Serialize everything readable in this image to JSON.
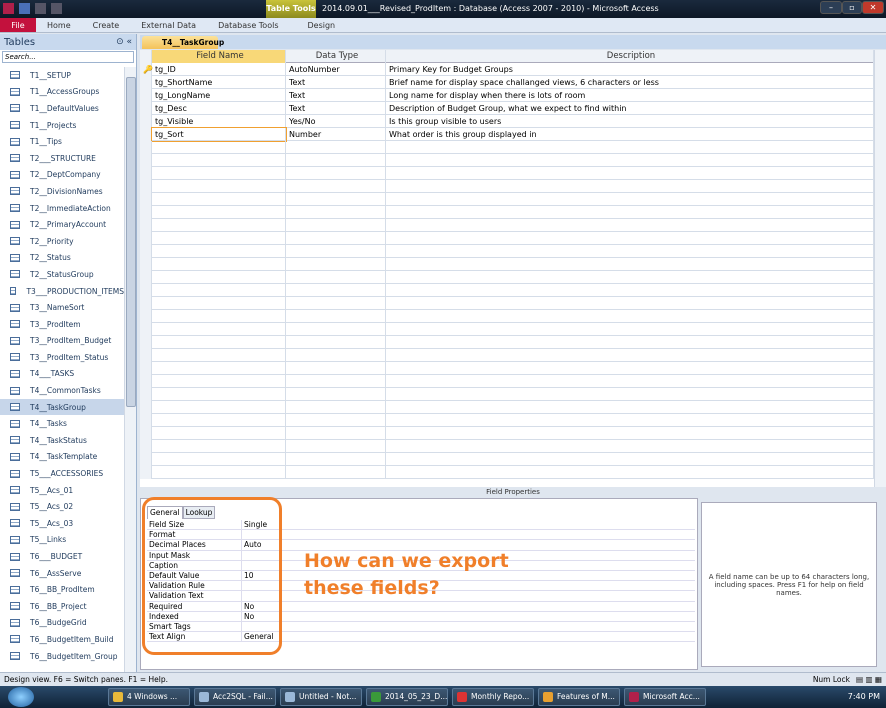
{
  "titlebar": {
    "context": "Table Tools",
    "title": "2014.09.01___Revised_ProdItem : Database (Access 2007 - 2010)  -  Microsoft Access",
    "min": "–",
    "max": "▫",
    "close": "✕"
  },
  "ribbon": {
    "tabs": [
      "File",
      "Home",
      "Create",
      "External Data",
      "Database Tools",
      "Design"
    ]
  },
  "nav": {
    "header": "Tables",
    "search_placeholder": "Search...",
    "items": [
      "T1__SETUP",
      "T1__AccessGroups",
      "T1__DefaultValues",
      "T1__Projects",
      "T1__Tips",
      "T2___STRUCTURE",
      "T2__DeptCompany",
      "T2__DivisionNames",
      "T2__ImmediateAction",
      "T2__PrimaryAccount",
      "T2__Priority",
      "T2__Status",
      "T2__StatusGroup",
      "T3___PRODUCTION_ITEMS",
      "T3__NameSort",
      "T3__ProdItem",
      "T3__ProdItem_Budget",
      "T3__ProdItem_Status",
      "T4___TASKS",
      "T4__CommonTasks",
      "T4__TaskGroup",
      "T4__Tasks",
      "T4__TaskStatus",
      "T4__TaskTemplate",
      "T5___ACCESSORIES",
      "T5__Acs_01",
      "T5__Acs_02",
      "T5__Acs_03",
      "T5__Links",
      "T6___BUDGET",
      "T6__AssServe",
      "T6__BB_ProdItem",
      "T6__BB_Project",
      "T6__BudgeGrid",
      "T6__BudgetItem_Build",
      "T6__BudgetItem_Group"
    ],
    "selected": 20
  },
  "doc": {
    "tab": "T4__TaskGroup"
  },
  "grid": {
    "headers": [
      "Field Name",
      "Data Type",
      "Description"
    ],
    "rows": [
      [
        "tg_ID",
        "AutoNumber",
        "Primary Key for Budget Groups"
      ],
      [
        "tg_ShortName",
        "Text",
        "Brief name for display space challanged views, 6 characters or less"
      ],
      [
        "tg_LongName",
        "Text",
        "Long name for display when there is lots of room"
      ],
      [
        "tg_Desc",
        "Text",
        "Description of Budget Group, what we expect to find within"
      ],
      [
        "tg_Visible",
        "Yes/No",
        "Is this group visible to users"
      ],
      [
        "tg_Sort",
        "Number",
        "What order is this group displayed in"
      ]
    ]
  },
  "props": {
    "header": "Field Properties",
    "tabs": [
      "General",
      "Lookup"
    ],
    "rows": [
      [
        "Field Size",
        "Single"
      ],
      [
        "Format",
        ""
      ],
      [
        "Decimal Places",
        "Auto"
      ],
      [
        "Input Mask",
        ""
      ],
      [
        "Caption",
        ""
      ],
      [
        "Default Value",
        "10"
      ],
      [
        "Validation Rule",
        ""
      ],
      [
        "Validation Text",
        ""
      ],
      [
        "Required",
        "No"
      ],
      [
        "Indexed",
        "No"
      ],
      [
        "Smart Tags",
        ""
      ],
      [
        "Text Align",
        "General"
      ]
    ],
    "help": "A field name can be up to 64 characters long, including spaces. Press F1 for help on field names."
  },
  "annotation": {
    "line1": "How can we export",
    "line2": "these fields?"
  },
  "status": {
    "left": "Design view.  F6 = Switch panes.  F1 = Help.",
    "numlock": "Num Lock"
  },
  "taskbar": {
    "items": [
      {
        "label": "4 Windows ...",
        "color": "#e8b93a"
      },
      {
        "label": "Acc2SQL - Fail...",
        "color": "#9ab8d8"
      },
      {
        "label": "Untitled - Not...",
        "color": "#9ab8d8"
      },
      {
        "label": "2014_05_23_D...",
        "color": "#3a9a3a"
      },
      {
        "label": "Monthly Repo...",
        "color": "#d33"
      },
      {
        "label": "Features of M...",
        "color": "#e8a030"
      },
      {
        "label": "Microsoft Acc...",
        "color": "#b0204a"
      }
    ],
    "time": "7:40 PM"
  }
}
